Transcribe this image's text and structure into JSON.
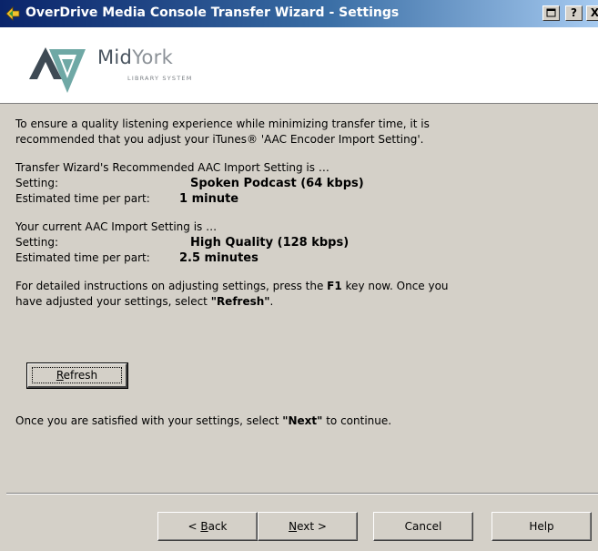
{
  "window": {
    "title": "OverDrive Media Console Transfer Wizard - Settings",
    "title_buttons": {
      "restore": "",
      "help": "?",
      "close": "X"
    }
  },
  "logo": {
    "mid": "Mid",
    "york": "York",
    "subtitle": "LIBRARY SYSTEM"
  },
  "intro": {
    "line1": "To ensure a quality listening experience while minimizing transfer time, it is",
    "line2": "recommended that you adjust your iTunes® 'AAC Encoder Import Setting'."
  },
  "recommended": {
    "heading": "Transfer Wizard's Recommended AAC Import Setting is …",
    "setting_label": "Setting:",
    "setting_value": "Spoken Podcast (64 kbps)",
    "time_label": "Estimated time per part:",
    "time_value": "1 minute"
  },
  "current": {
    "heading": "Your current AAC Import Setting is …",
    "setting_label": "Setting:",
    "setting_value": "High Quality (128 kbps)",
    "time_label": "Estimated time per part:",
    "time_value": "2.5 minutes"
  },
  "instructions": {
    "part1": "For detailed instructions on adjusting settings, press the ",
    "key": "F1",
    "part2": " key now.  Once you",
    "part3": "have adjusted your settings, select ",
    "refresh_quote": "\"Refresh\"",
    "part4": "."
  },
  "refresh_button": {
    "hotkey": "R",
    "rest": "efresh"
  },
  "satisfied": {
    "part1": "Once you are satisfied with your settings, select ",
    "next_quote": "\"Next\"",
    "part2": " to continue."
  },
  "buttons": {
    "back_prefix": "< ",
    "back_hotkey": "B",
    "back_rest": "ack",
    "next_hotkey": "N",
    "next_rest": "ext >",
    "cancel": "Cancel",
    "help": "Help"
  }
}
